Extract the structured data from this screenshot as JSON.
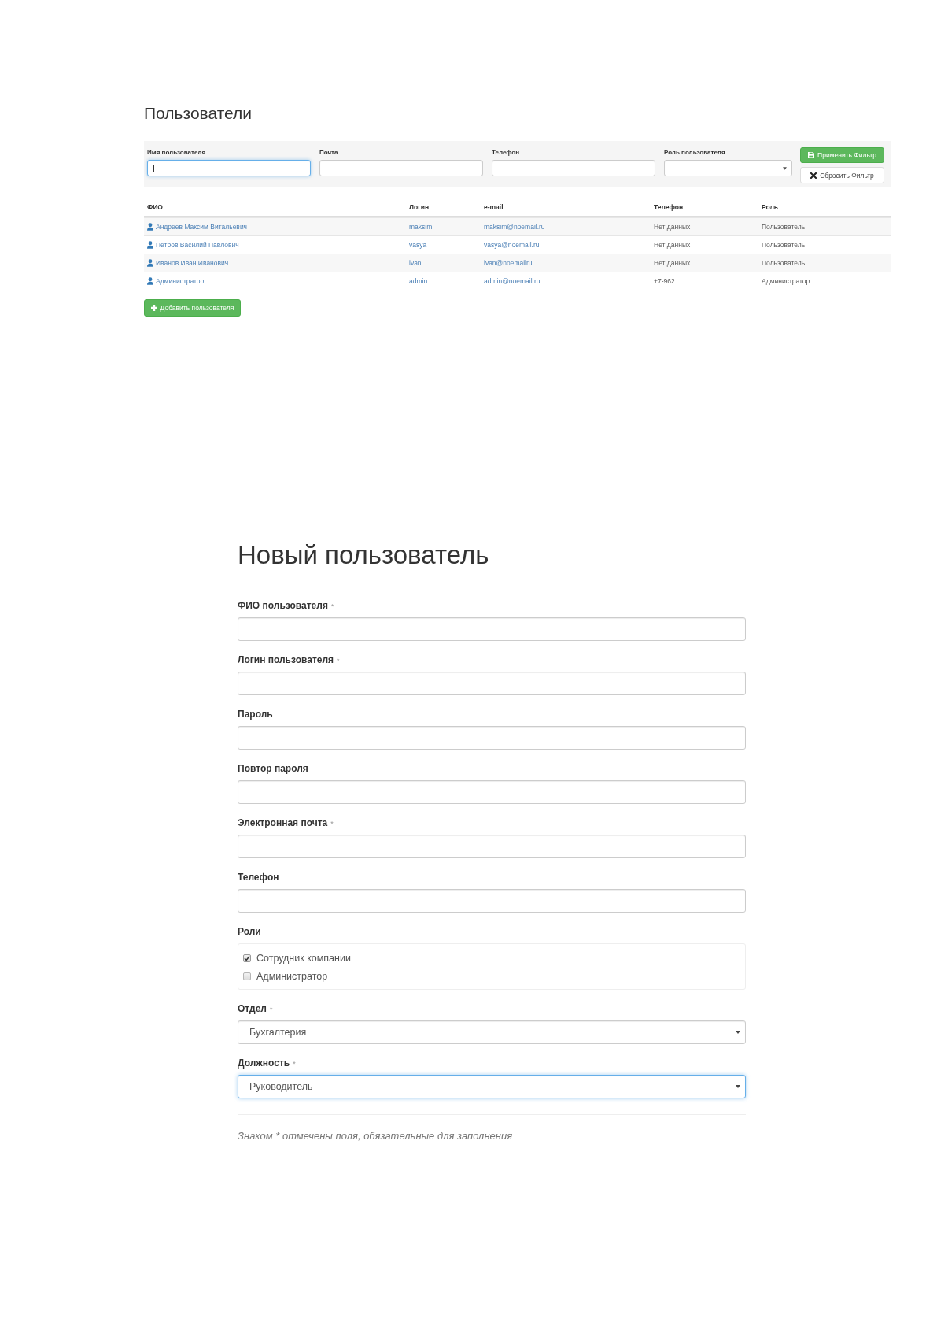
{
  "users_page": {
    "title": "Пользователи",
    "filter": {
      "fields": [
        {
          "kind": "input",
          "label": "Имя пользователя",
          "focused": true
        },
        {
          "kind": "input",
          "label": "Почта",
          "focused": false
        },
        {
          "kind": "input",
          "label": "Телефон",
          "focused": false
        },
        {
          "kind": "select",
          "label": "Роль пользователя",
          "focused": false
        }
      ],
      "apply_button": "Применить Фильтр",
      "reset_button": "Сбросить Фильтр"
    },
    "table": {
      "columns": [
        "ФИО",
        "Логин",
        "e-mail",
        "Телефон",
        "Роль"
      ],
      "rows": [
        {
          "name": "Андреев Максим Витальевич",
          "login": "maksim",
          "email": "maksim@noemail.ru",
          "phone": "Нет данных",
          "role": "Пользователь"
        },
        {
          "name": "Петров Василий Павлович",
          "login": "vasya",
          "email": "vasya@noemail.ru",
          "phone": "Нет данных",
          "role": "Пользователь"
        },
        {
          "name": "Иванов Иван Иванович",
          "login": "ivan",
          "email": "ivan@noemailru",
          "phone": "Нет данных",
          "role": "Пользователь"
        },
        {
          "name": "Администратор",
          "login": "admin",
          "email": "admin@noemail.ru",
          "phone": "+7-962",
          "role": "Администратор"
        }
      ]
    },
    "add_button": "Добавить пользователя"
  },
  "new_user_form": {
    "title": "Новый пользователь",
    "fields": [
      {
        "kind": "input",
        "label": "ФИО пользователя",
        "mark": "*",
        "focused": false
      },
      {
        "kind": "input",
        "label": "Логин пользователя",
        "mark": "*",
        "focused": false
      },
      {
        "kind": "input",
        "label": "Пароль",
        "focused": false
      },
      {
        "kind": "input",
        "label": "Повтор пароля",
        "focused": false
      },
      {
        "kind": "input",
        "label": "Электронная почта",
        "mark": "*",
        "focused": false
      },
      {
        "kind": "input",
        "label": "Телефон",
        "focused": false
      },
      {
        "kind": "checkboxes",
        "label": "Роли",
        "options": [
          {
            "label": "Сотрудник компании",
            "checked": true
          },
          {
            "label": "Администратор",
            "checked": false
          }
        ]
      },
      {
        "kind": "select",
        "label": "Отдел",
        "mark": "*",
        "value": "Бухгалтерия",
        "focused": false
      },
      {
        "kind": "select",
        "label": "Должность",
        "mark": "*",
        "value": "Руководитель",
        "focused": true
      }
    ],
    "note": "Знаком * отмечены поля, обязательные для заполнения"
  }
}
